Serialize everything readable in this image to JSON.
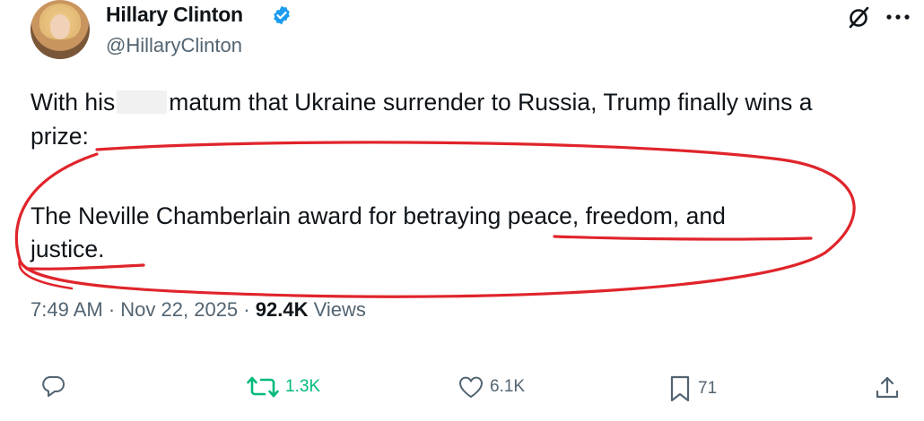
{
  "author": {
    "display_name": "Hillary Clinton",
    "handle": "@HillaryClinton",
    "avatar": "profile-photo"
  },
  "icons": {
    "verified": "verified-badge-icon",
    "grok": "grok-icon",
    "more": "more-icon",
    "reply": "reply-icon",
    "retweet": "retweet-icon",
    "like": "like-icon",
    "bookmark": "bookmark-icon",
    "share": "share-icon"
  },
  "tweet": {
    "line1_before": "With his",
    "line1_after": "matum that Ukraine surrender to Russia, Trump finally wins a",
    "line2": "prize:",
    "line3": "The Neville Chamberlain award for betraying peace, freedom, and",
    "line4": "justice."
  },
  "meta": {
    "time": "7:49 AM",
    "separator": "·",
    "date": "Nov 22, 2025",
    "views_count": "92.4K",
    "views_label": "Views"
  },
  "actions": {
    "reply_count": "",
    "retweet_count": "1.3K",
    "like_count": "6.1K",
    "bookmark_count": "71"
  },
  "colors": {
    "text": "#0f1419",
    "secondary": "#536471",
    "verified": "#1d9bf0",
    "retweet_green": "#00ba7c",
    "annotation_red": "#e0242b"
  }
}
